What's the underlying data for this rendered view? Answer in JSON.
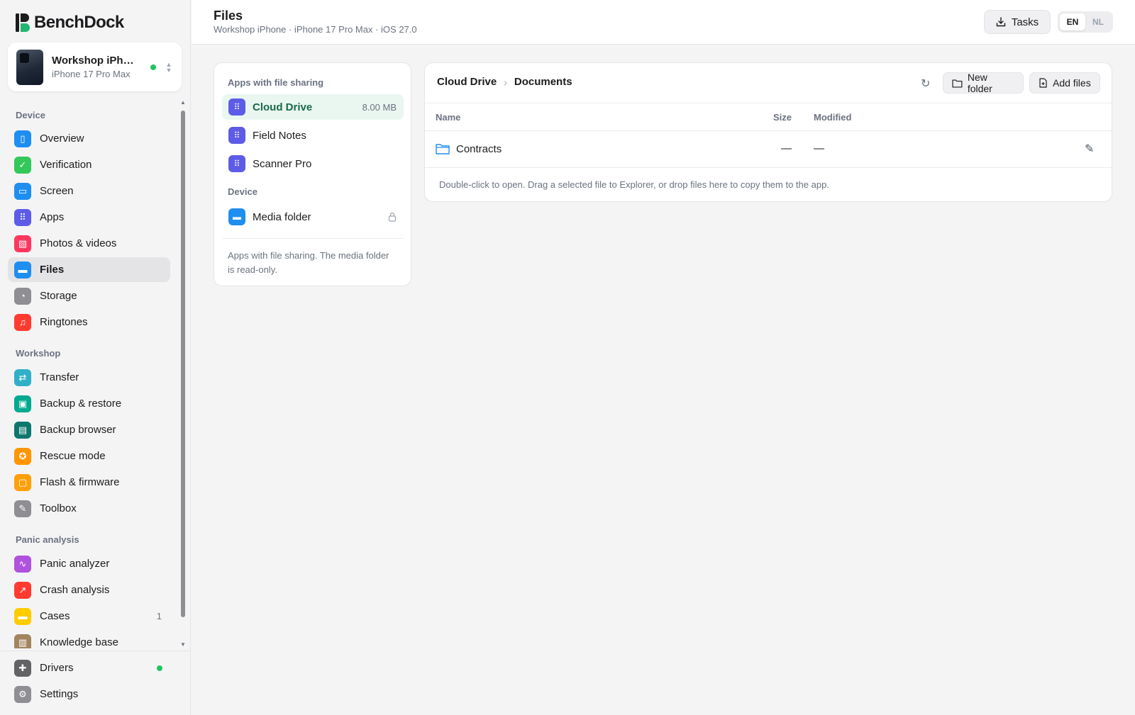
{
  "app": {
    "logo_text_1": "Bench",
    "logo_text_2": "Dock",
    "device_name": "Workshop iPhone",
    "device_model": "iPhone 17 Pro Max"
  },
  "sidebar": {
    "sections": [
      {
        "label": "Device"
      },
      {
        "label": "Workshop"
      },
      {
        "label": "Panic analysis"
      }
    ],
    "items": [
      {
        "label": "Overview",
        "icon": "phone-icon",
        "color": "#1f8ef1"
      },
      {
        "label": "Verification",
        "icon": "shield-check-icon",
        "color": "#34c759"
      },
      {
        "label": "Screen",
        "icon": "screen-icon",
        "color": "#1f8ef1"
      },
      {
        "label": "Apps",
        "icon": "apps-grid-icon",
        "color": "#5e5ce6"
      },
      {
        "label": "Photos & videos",
        "icon": "photos-icon",
        "color": "#ff375f"
      },
      {
        "label": "Files",
        "icon": "folder-icon",
        "color": "#1f8ef1"
      },
      {
        "label": "Storage",
        "icon": "pie-chart-icon",
        "color": "#8e8e93"
      },
      {
        "label": "Ringtones",
        "icon": "music-note-icon",
        "color": "#ff3b30"
      },
      {
        "label": "Transfer",
        "icon": "transfer-arrows-icon",
        "color": "#30b0c7"
      },
      {
        "label": "Backup & restore",
        "icon": "archive-icon",
        "color": "#00a98f"
      },
      {
        "label": "Backup browser",
        "icon": "inbox-icon",
        "color": "#0f766e"
      },
      {
        "label": "Rescue mode",
        "icon": "lifebuoy-icon",
        "color": "#ff9500"
      },
      {
        "label": "Flash & firmware",
        "icon": "chip-icon",
        "color": "#ff9f0a"
      },
      {
        "label": "Toolbox",
        "icon": "wrench-icon",
        "color": "#8e8e93"
      },
      {
        "label": "Panic analyzer",
        "icon": "pulse-icon",
        "color": "#af52de"
      },
      {
        "label": "Crash analysis",
        "icon": "trend-icon",
        "color": "#ff3b30"
      },
      {
        "label": "Cases",
        "icon": "case-folder-icon",
        "color": "#ffcc00",
        "count": "1"
      },
      {
        "label": "Knowledge base",
        "icon": "book-icon",
        "color": "#a2845e"
      }
    ],
    "bottom": [
      {
        "label": "Drivers",
        "icon": "puzzle-icon",
        "color": "#636366"
      },
      {
        "label": "Settings",
        "icon": "gear-icon",
        "color": "#8e8e93"
      }
    ]
  },
  "header": {
    "title": "Files",
    "subtitle": "Workshop iPhone · iPhone 17 Pro Max · iOS 27.0",
    "tasks_label": "Tasks",
    "lang_en": "EN",
    "lang_nl": "NL"
  },
  "apps_panel": {
    "heading_apps": "Apps with file sharing",
    "heading_device": "Device",
    "apps": [
      {
        "label": "Cloud Drive",
        "size": "8.00 MB",
        "color": "#5e5ce6"
      },
      {
        "label": "Field Notes",
        "color": "#5e5ce6"
      },
      {
        "label": "Scanner Pro",
        "color": "#5e5ce6"
      }
    ],
    "device_items": [
      {
        "label": "Media folder",
        "color": "#1f8ef1"
      }
    ],
    "note": "Apps with file sharing. The media folder is read-only."
  },
  "browser": {
    "crumbs": [
      "Cloud Drive",
      "Documents"
    ],
    "new_folder_label": "New folder",
    "add_files_label": "Add files",
    "columns": {
      "name": "Name",
      "size": "Size",
      "modified": "Modified"
    },
    "rows": [
      {
        "name": "Contracts",
        "size": "—",
        "modified": "—"
      }
    ],
    "hint": "Double-click to open. Drag a selected file to Explorer, or drop files here to copy them to the app."
  }
}
